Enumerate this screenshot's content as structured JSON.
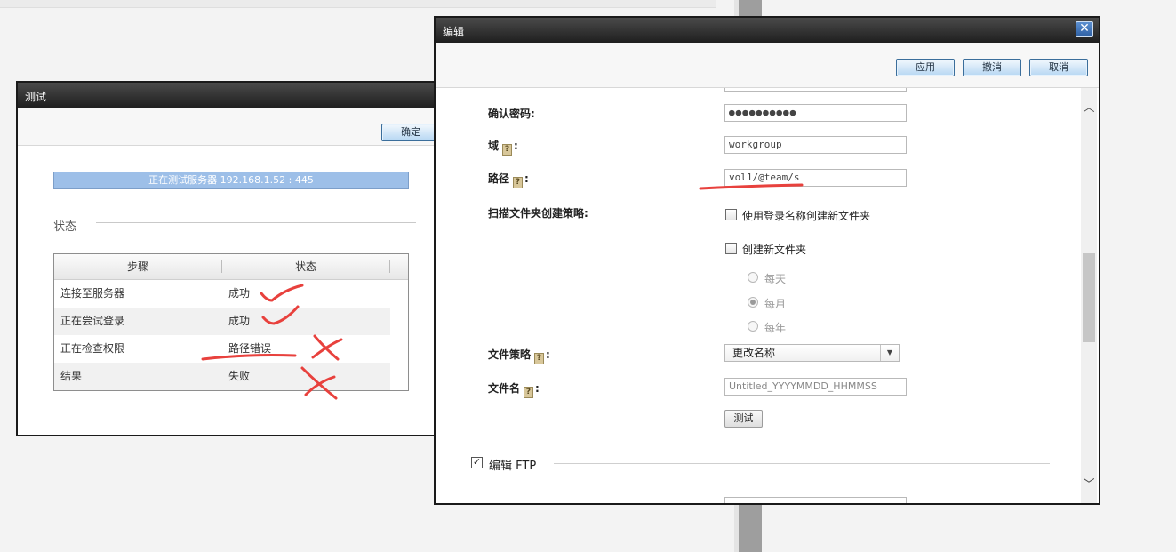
{
  "test_dialog": {
    "title": "测试",
    "ok_label": "确定",
    "progress_text": "正在测试服务器 192.168.1.52 : 445",
    "section_label": "状态",
    "table": {
      "headers": [
        "步骤",
        "状态"
      ],
      "rows": [
        {
          "step": "连接至服务器",
          "status": "成功"
        },
        {
          "step": "正在尝试登录",
          "status": "成功"
        },
        {
          "step": "正在检查权限",
          "status": "路径错误"
        },
        {
          "step": "结果",
          "status": "失败"
        }
      ]
    }
  },
  "edit_dialog": {
    "title": "编辑",
    "close_glyph": "✕",
    "apply_label": "应用",
    "undo_label": "撤消",
    "cancel_label": "取消",
    "fields": {
      "confirm_password_label": "确认密码:",
      "confirm_password_value": "●●●●●●●●●●",
      "domain_label": "域",
      "domain_value": "workgroup",
      "path_label": "路径",
      "path_value": "vol1/@team/s",
      "scan_folder_label": "扫描文件夹创建策略:",
      "use_login_name_label": "使用登录名称创建新文件夹",
      "create_new_folder_label": "创建新文件夹",
      "radio_daily": "每天",
      "radio_monthly": "每月",
      "radio_yearly": "每年",
      "file_policy_label": "文件策略",
      "file_policy_value": "更改名称",
      "file_name_label": "文件名",
      "file_name_placeholder": "Untitled_YYYYMMDD_HHMMSS",
      "test_button": "测试",
      "ftp_label": "编辑 FTP"
    },
    "help_glyph": "?",
    "colon": ":"
  },
  "annotation_color": "#e8413d"
}
